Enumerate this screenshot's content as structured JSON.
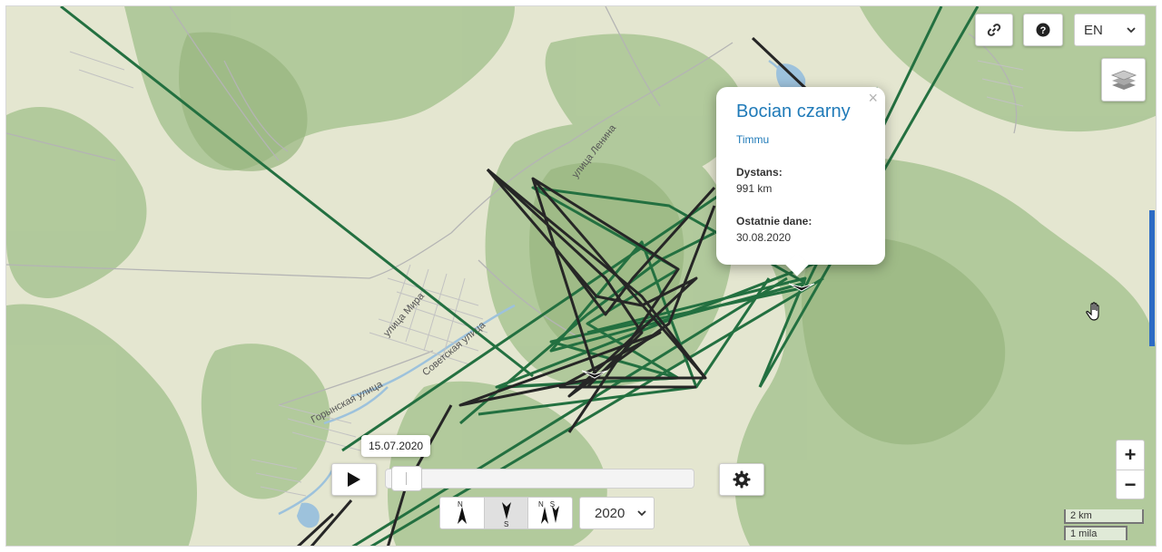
{
  "map": {
    "colors": {
      "bird_a": "#262626",
      "bird_b": "#237040",
      "forest": "#a3bf8c",
      "meadow": "#e6e7d3",
      "road": "#a6a6a6",
      "water": "#9dc2dc"
    },
    "street_labels": [
      "улица Ленина",
      "улица Мира",
      "Советская улица",
      "Горынская улица"
    ]
  },
  "toolbar": {
    "link_icon": "link-icon",
    "help_icon": "question-circle-icon",
    "language": "EN",
    "layers_icon": "layers-icon"
  },
  "popup": {
    "title": "Bocian czarny",
    "subtitle": "Timmu",
    "distance_label": "Dystans:",
    "distance_value": "991 km",
    "last_data_label": "Ostatnie dane:",
    "last_data_value": "30.08.2020",
    "close_symbol": "×"
  },
  "timeline": {
    "date": "15.07.2020",
    "progress": 0.0,
    "play_icon": "play-icon",
    "settings_icon": "gear-icon",
    "orientation_options": [
      {
        "label": "N",
        "icon": "north-arrow-icon"
      },
      {
        "label": "S",
        "icon": "south-arrow-icon",
        "active": true
      },
      {
        "label": "NS",
        "icon": "north-south-arrow-icon"
      }
    ],
    "year": "2020"
  },
  "zoom": {
    "in": "+",
    "out": "−"
  },
  "scale": {
    "km": "2 km",
    "mi": "1 mila"
  }
}
